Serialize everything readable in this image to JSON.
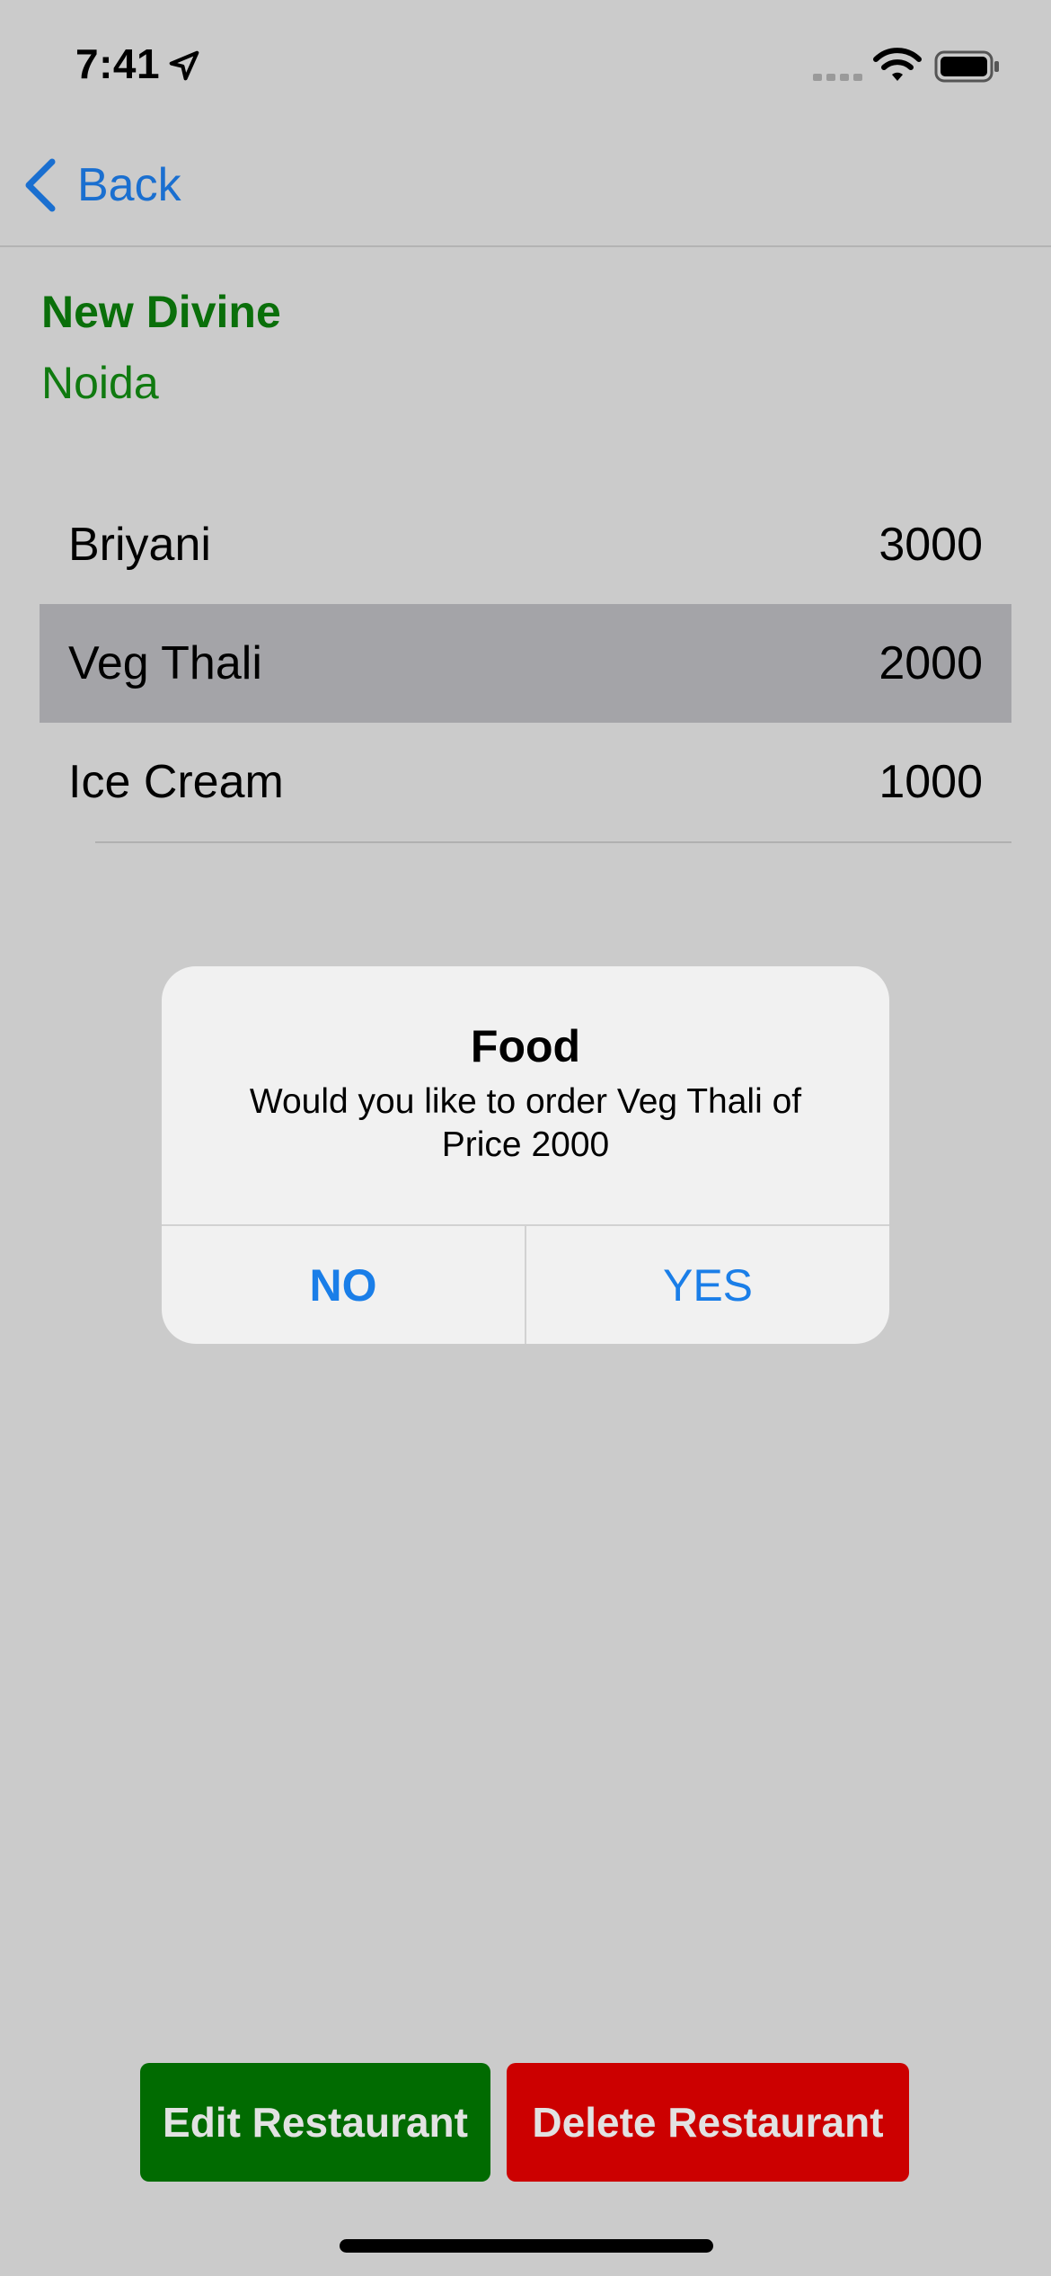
{
  "status_bar": {
    "time": "7:41",
    "icons": [
      "location-arrow-icon",
      "signal-icon",
      "wifi-icon",
      "battery-icon"
    ]
  },
  "nav": {
    "back_label": "Back",
    "back_icon": "chevron-left-icon"
  },
  "restaurant": {
    "name": "New Divine",
    "city": "Noida"
  },
  "menu": {
    "items": [
      {
        "name": "Briyani",
        "price": "3000"
      },
      {
        "name": "Veg Thali",
        "price": "2000"
      },
      {
        "name": "Ice Cream",
        "price": "1000"
      }
    ],
    "selected_index": 1
  },
  "alert": {
    "title": "Food",
    "message": "Would you like to order Veg Thali of Price 2000",
    "no_label": "NO",
    "yes_label": "YES"
  },
  "actions": {
    "edit_label": "Edit Restaurant",
    "delete_label": "Delete Restaurant"
  },
  "colors": {
    "background": "#cbcbcb",
    "accent_blue": "#1a6fd0",
    "brand_green": "#0a6f0a",
    "edit_button": "#016b01",
    "delete_button": "#cc0000",
    "selected_row": "#a4a4a8"
  }
}
